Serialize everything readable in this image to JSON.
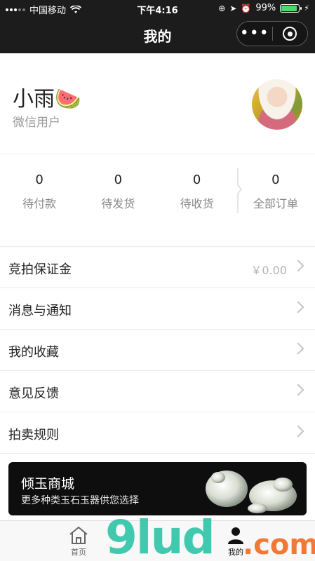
{
  "status_bar": {
    "carrier": "中国移动",
    "time": "下午4:16",
    "battery": "99%"
  },
  "nav": {
    "title": "我的",
    "more_label": "•••"
  },
  "profile": {
    "name": "小雨🍉",
    "subtitle": "微信用户"
  },
  "orders": [
    {
      "count": "0",
      "label": "待付款"
    },
    {
      "count": "0",
      "label": "待发货"
    },
    {
      "count": "0",
      "label": "待收货"
    },
    {
      "count": "0",
      "label": "全部订单"
    }
  ],
  "menu": [
    {
      "label": "竞拍保证金",
      "value": "￥0.00"
    },
    {
      "label": "消息与通知",
      "value": ""
    },
    {
      "label": "我的收藏",
      "value": ""
    },
    {
      "label": "意见反馈",
      "value": ""
    },
    {
      "label": "拍卖规则",
      "value": ""
    }
  ],
  "banner": {
    "title": "倾玉商城",
    "subtitle": "更多种类玉石玉器供您选择"
  },
  "tabbar": {
    "home_label": "首页",
    "mine_label": "我的"
  },
  "watermark": {
    "text": "9lud",
    "suffix": ".com"
  },
  "colors": {
    "header_bg": "#1c1c1c",
    "battery": "#4cd964",
    "watermark": "#2ec4a8",
    "watermark_suffix": "#f26b21"
  }
}
